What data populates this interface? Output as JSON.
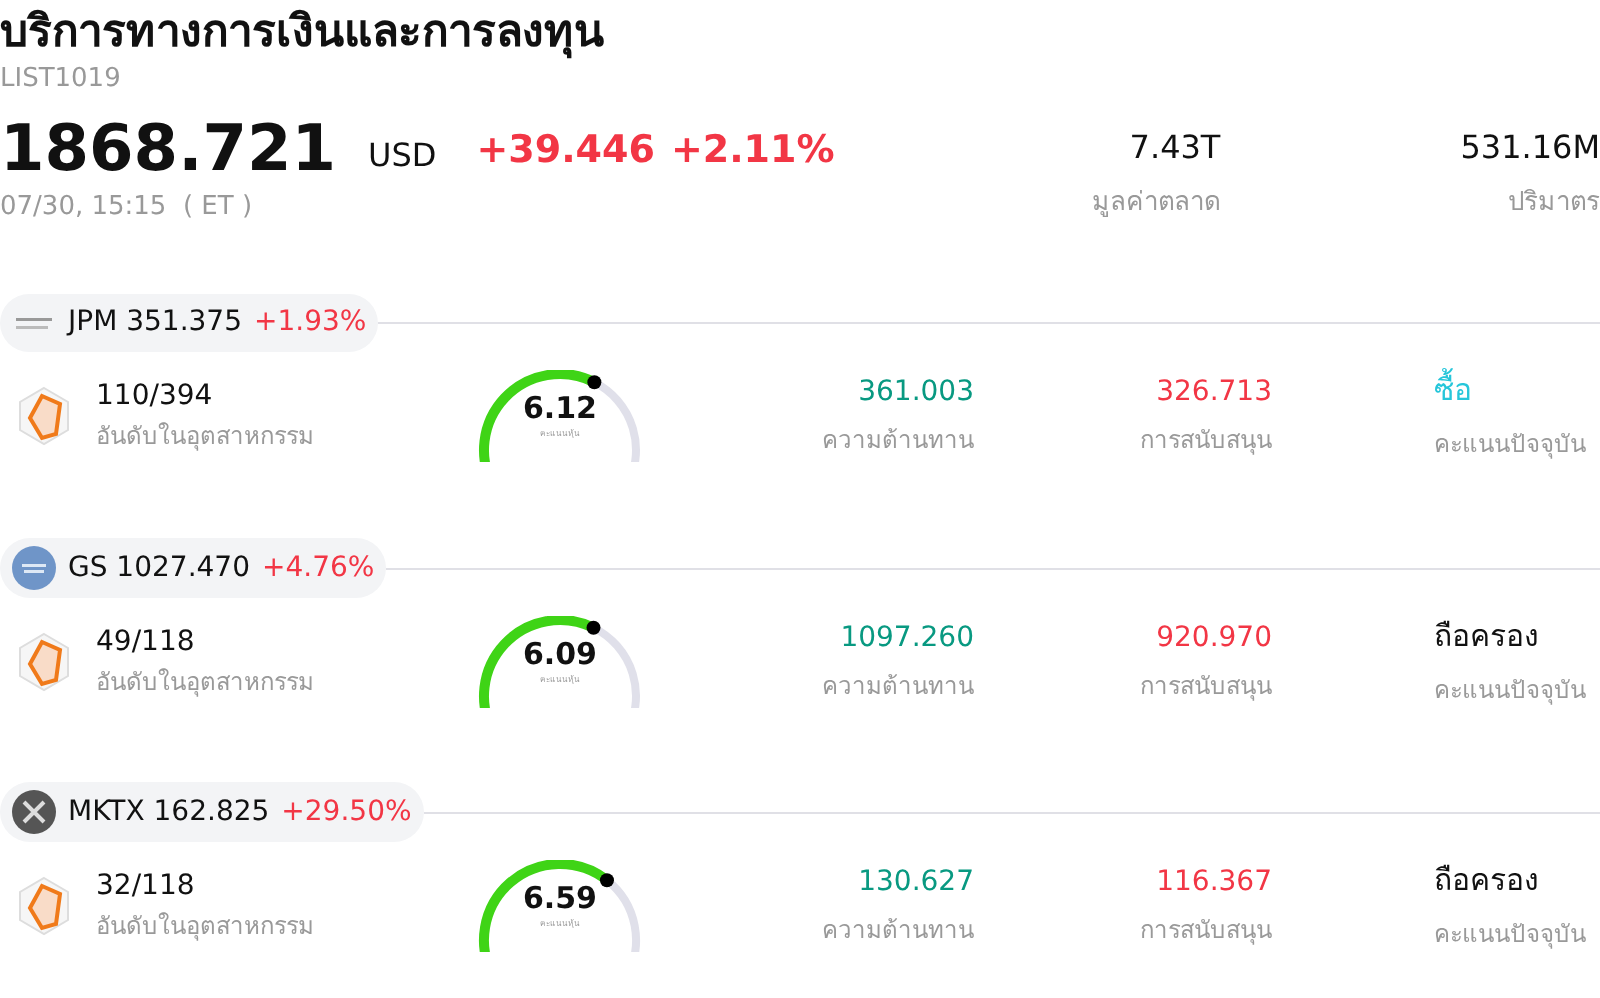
{
  "title": "บริการทางการเงินและการลงทุน",
  "code": "LIST1019",
  "quote": {
    "price": "1868.721",
    "currency": "USD",
    "change": "+39.446",
    "change_pct": "+2.11%",
    "time": "07/30, 15:15  ( ET )"
  },
  "stats": [
    {
      "value": "7.43T",
      "label": "มูลค่าตลาด"
    },
    {
      "value": "531.16M",
      "label": "ปริมาตร"
    }
  ],
  "stocks": [
    {
      "ticker": "JPM",
      "price": "351.375",
      "change": "+1.93%",
      "rank": "110/394",
      "rank_label": "อันดับในอุตสาหกรรม",
      "score": "6.12",
      "score_label": "คะแนนหุ้น",
      "resistance": "361.003",
      "resistance_label": "ความต้านทาน",
      "support": "326.713",
      "support_label": "การสนับสนุน",
      "rating": "ซื้อ",
      "color": "#26c6da",
      "rating_label": "คะแนนปัจจุบัน"
    },
    {
      "ticker": "GS",
      "price": "1027.470",
      "change": "+4.76%",
      "rank": "49/118",
      "rank_label": "อันดับในอุตสาหกรรม",
      "score": "6.09",
      "score_label": "คะแนนหุ้น",
      "resistance": "1097.260",
      "resistance_label": "ความต้านทาน",
      "support": "920.970",
      "support_label": "การสนับสนุน",
      "rating": "ถือครอง",
      "color": "#111111",
      "rating_label": "คะแนนปัจจุบัน"
    },
    {
      "ticker": "MKTX",
      "price": "162.825",
      "change": "+29.50%",
      "rank": "32/118",
      "rank_label": "อันดับในอุตสาหกรรม",
      "score": "6.59",
      "score_label": "คะแนนหุ้น",
      "resistance": "130.627",
      "resistance_label": "ความต้านทาน",
      "support": "116.367",
      "support_label": "การสนับสนุน",
      "rating": "ถือครอง",
      "color": "#111111",
      "rating_label": "คะแนนปัจจุบัน"
    }
  ]
}
